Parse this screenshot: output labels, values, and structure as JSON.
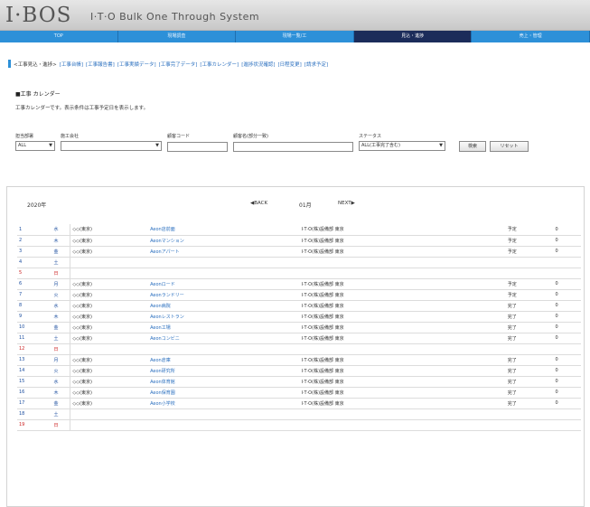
{
  "app": {
    "logo": "I·BOS",
    "subtitle": "I·T·O Bulk One Through System"
  },
  "nav": {
    "items": [
      {
        "label": "TOP"
      },
      {
        "label": "現場調査"
      },
      {
        "label": "現場一覧/工"
      },
      {
        "label": "見込・進捗",
        "active": true
      },
      {
        "label": "売上・管理"
      }
    ]
  },
  "breadcrumb": {
    "current": "<工事見込・進捗>",
    "links": [
      "[工事台帳]",
      "[工事報告書]",
      "[工事実績データ]",
      "[工事完了データ]",
      "[工事カレンダー]",
      "[進捗状況確認]",
      "[日程変更]",
      "[請求予定]"
    ]
  },
  "section": {
    "title": "■工事 カレンダー",
    "description": "工事カレンダーです。表示条件は工事予定日を表示します。"
  },
  "filters": {
    "dept_label": "担当部署",
    "dept_value": "ALL",
    "company_label": "施工会社",
    "company_value": "",
    "code_label": "顧客コード",
    "name_label": "顧客名(部分一致)",
    "status_label": "ステータス",
    "status_value": "ALL(工事完了含む)",
    "search_button": "検索",
    "reset_button": "リセット"
  },
  "calendar": {
    "year": "2020年",
    "month": "01月",
    "back": "◀BACK",
    "next": "NEXT▶",
    "rows": [
      {
        "day": "1",
        "wd": "水",
        "type": "weekday",
        "cust": "◇◇(東京)",
        "site": "Aeon店前面",
        "co": "I·T·O(株)設備部 東京",
        "st": "予定",
        "mk": "0"
      },
      {
        "day": "2",
        "wd": "木",
        "type": "weekday",
        "cust": "◇◇(東京)",
        "site": "Aeonマンション",
        "co": "I·T·O(株)設備部 東京",
        "st": "予定",
        "mk": "0"
      },
      {
        "day": "3",
        "wd": "金",
        "type": "weekday",
        "cust": "◇◇(東京)",
        "site": "Aeonアパート",
        "co": "I·T·O(株)設備部 東京",
        "st": "予定",
        "mk": "0"
      },
      {
        "day": "4",
        "wd": "土",
        "type": "sat",
        "cust": "",
        "site": "",
        "co": "",
        "st": "",
        "mk": ""
      },
      {
        "day": "5",
        "wd": "日",
        "type": "sun",
        "cust": "",
        "site": "",
        "co": "",
        "st": "",
        "mk": ""
      },
      {
        "day": "6",
        "wd": "月",
        "type": "weekday",
        "cust": "◇◇(東京)",
        "site": "Aeonロード",
        "co": "I·T·O(株)設備部 東京",
        "st": "予定",
        "mk": "0"
      },
      {
        "day": "7",
        "wd": "火",
        "type": "weekday",
        "cust": "◇◇(東京)",
        "site": "Aeonランドリー",
        "co": "I·T·O(株)設備部 東京",
        "st": "予定",
        "mk": "0"
      },
      {
        "day": "8",
        "wd": "水",
        "type": "weekday",
        "cust": "◇◇(東京)",
        "site": "Aeon病院",
        "co": "I·T·O(株)設備部 東京",
        "st": "完了",
        "mk": "0"
      },
      {
        "day": "9",
        "wd": "木",
        "type": "weekday",
        "cust": "◇◇(東京)",
        "site": "Aeonレストラン",
        "co": "I·T·O(株)設備部 東京",
        "st": "完了",
        "mk": "0"
      },
      {
        "day": "10",
        "wd": "金",
        "type": "weekday",
        "cust": "◇◇(東京)",
        "site": "Aeon工場",
        "co": "I·T·O(株)設備部 東京",
        "st": "完了",
        "mk": "0"
      },
      {
        "day": "11",
        "wd": "土",
        "type": "sat",
        "cust": "◇◇(東京)",
        "site": "Aeonコンビニ",
        "co": "I·T·O(株)設備部 東京",
        "st": "完了",
        "mk": "0"
      },
      {
        "day": "12",
        "wd": "日",
        "type": "sun",
        "cust": "",
        "site": "",
        "co": "",
        "st": "",
        "mk": ""
      },
      {
        "day": "13",
        "wd": "月",
        "type": "weekday",
        "cust": "◇◇(東京)",
        "site": "Aeon倉庫",
        "co": "I·T·O(株)設備部 東京",
        "st": "完了",
        "mk": "0"
      },
      {
        "day": "14",
        "wd": "火",
        "type": "weekday",
        "cust": "◇◇(東京)",
        "site": "Aeon研究所",
        "co": "I·T·O(株)設備部 東京",
        "st": "完了",
        "mk": "0"
      },
      {
        "day": "15",
        "wd": "水",
        "type": "weekday",
        "cust": "◇◇(東京)",
        "site": "Aeon体育館",
        "co": "I·T·O(株)設備部 東京",
        "st": "完了",
        "mk": "0"
      },
      {
        "day": "16",
        "wd": "木",
        "type": "weekday",
        "cust": "◇◇(東京)",
        "site": "Aeon保育園",
        "co": "I·T·O(株)設備部 東京",
        "st": "完了",
        "mk": "0"
      },
      {
        "day": "17",
        "wd": "金",
        "type": "weekday",
        "cust": "◇◇(東京)",
        "site": "Aeon小学校",
        "co": "I·T·O(株)設備部 東京",
        "st": "完了",
        "mk": "0"
      },
      {
        "day": "18",
        "wd": "土",
        "type": "sat",
        "cust": "",
        "site": "",
        "co": "",
        "st": "",
        "mk": ""
      },
      {
        "day": "19",
        "wd": "日",
        "type": "sun",
        "cust": "",
        "site": "",
        "co": "",
        "st": "",
        "mk": ""
      }
    ]
  }
}
